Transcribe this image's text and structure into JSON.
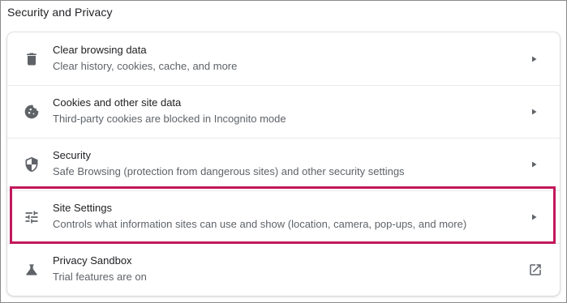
{
  "section": {
    "title": "Security and Privacy"
  },
  "highlight_color": "#c2185b",
  "rows": [
    {
      "label": "Clear browsing data",
      "sub": "Clear history, cookies, cache, and more",
      "icon": "trash-icon",
      "action": "chevron-right-icon"
    },
    {
      "label": "Cookies and other site data",
      "sub": "Third-party cookies are blocked in Incognito mode",
      "icon": "cookie-icon",
      "action": "chevron-right-icon"
    },
    {
      "label": "Security",
      "sub": "Safe Browsing (protection from dangerous sites) and other security settings",
      "icon": "shield-icon",
      "action": "chevron-right-icon"
    },
    {
      "label": "Site Settings",
      "sub": "Controls what information sites can use and show (location, camera, pop-ups, and more)",
      "icon": "tune-icon",
      "action": "chevron-right-icon"
    },
    {
      "label": "Privacy Sandbox",
      "sub": "Trial features are on",
      "icon": "flask-icon",
      "action": "open-in-new-icon"
    }
  ]
}
